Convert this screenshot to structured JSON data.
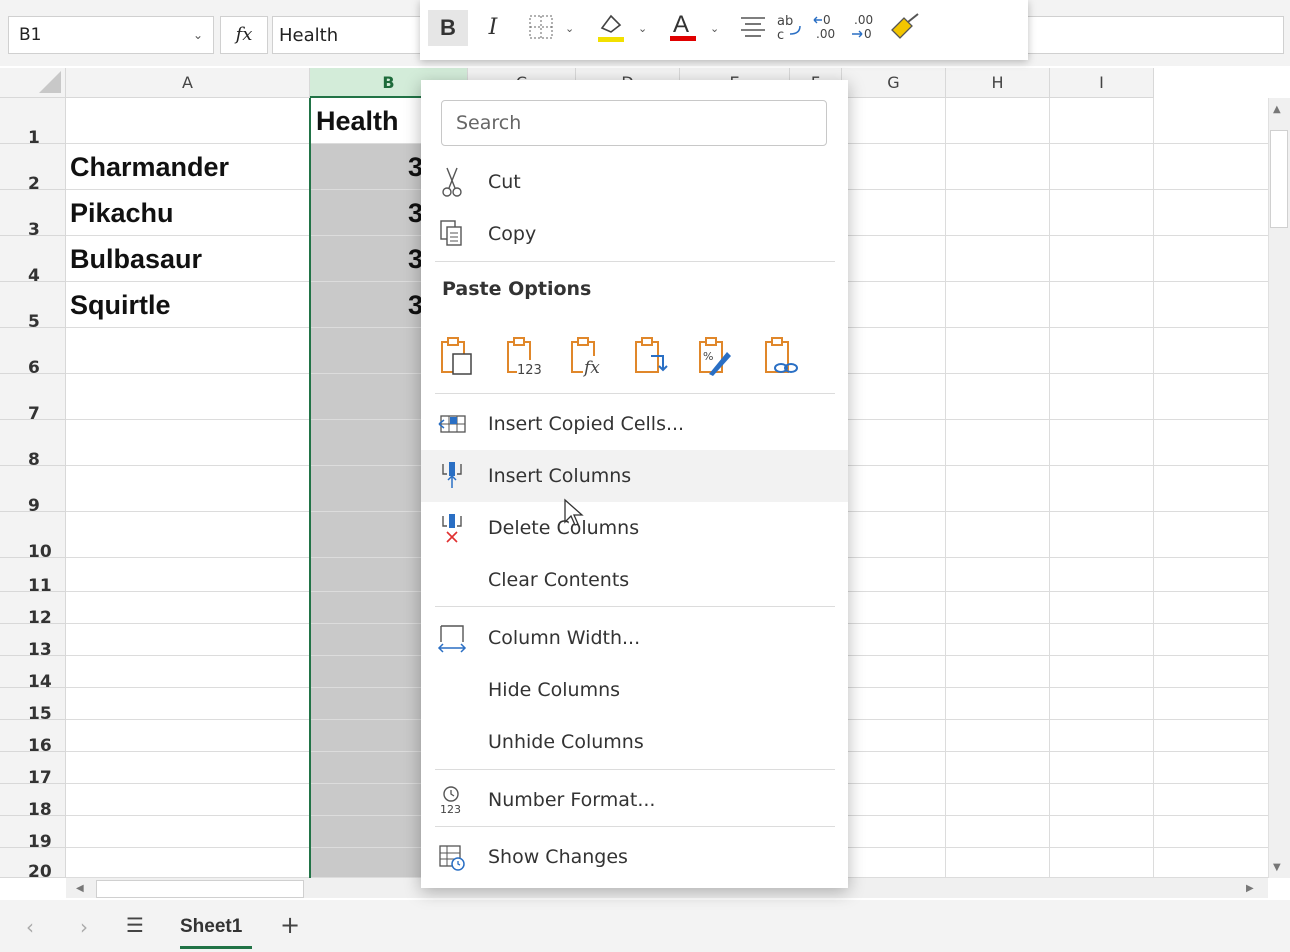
{
  "formula_bar": {
    "name_box": "B1",
    "fx_label": "fx",
    "formula": "Health"
  },
  "toolbar": {
    "bold": "B",
    "italic": "I"
  },
  "grid": {
    "columns": [
      "A",
      "B",
      "C",
      "D",
      "E",
      "F",
      "G",
      "H",
      "I"
    ],
    "rows": [
      "1",
      "2",
      "3",
      "4",
      "5",
      "6",
      "7",
      "8",
      "9",
      "10",
      "11",
      "12",
      "13",
      "14",
      "15",
      "16",
      "17",
      "18",
      "19",
      "20"
    ],
    "header_b1": "Health",
    "names": [
      "Charmander",
      "Pikachu",
      "Bulbasaur",
      "Squirtle"
    ],
    "b_values_visible": [
      "3",
      "3",
      "3",
      "3"
    ]
  },
  "context_menu": {
    "search_placeholder": "Search",
    "cut": "Cut",
    "copy": "Copy",
    "paste_options": "Paste Options",
    "insert_copied_cells": "Insert Copied Cells...",
    "insert_columns": "Insert Columns",
    "delete_columns": "Delete Columns",
    "clear_contents": "Clear Contents",
    "column_width": "Column Width...",
    "hide_columns": "Hide Columns",
    "unhide_columns": "Unhide Columns",
    "number_format": "Number Format...",
    "show_changes": "Show Changes"
  },
  "sheets": {
    "active": "Sheet1"
  },
  "colors": {
    "accent_green": "#217346",
    "highlight_yellow": "#f2e000",
    "font_red": "#e00000",
    "paste_orange": "#e0872a"
  }
}
